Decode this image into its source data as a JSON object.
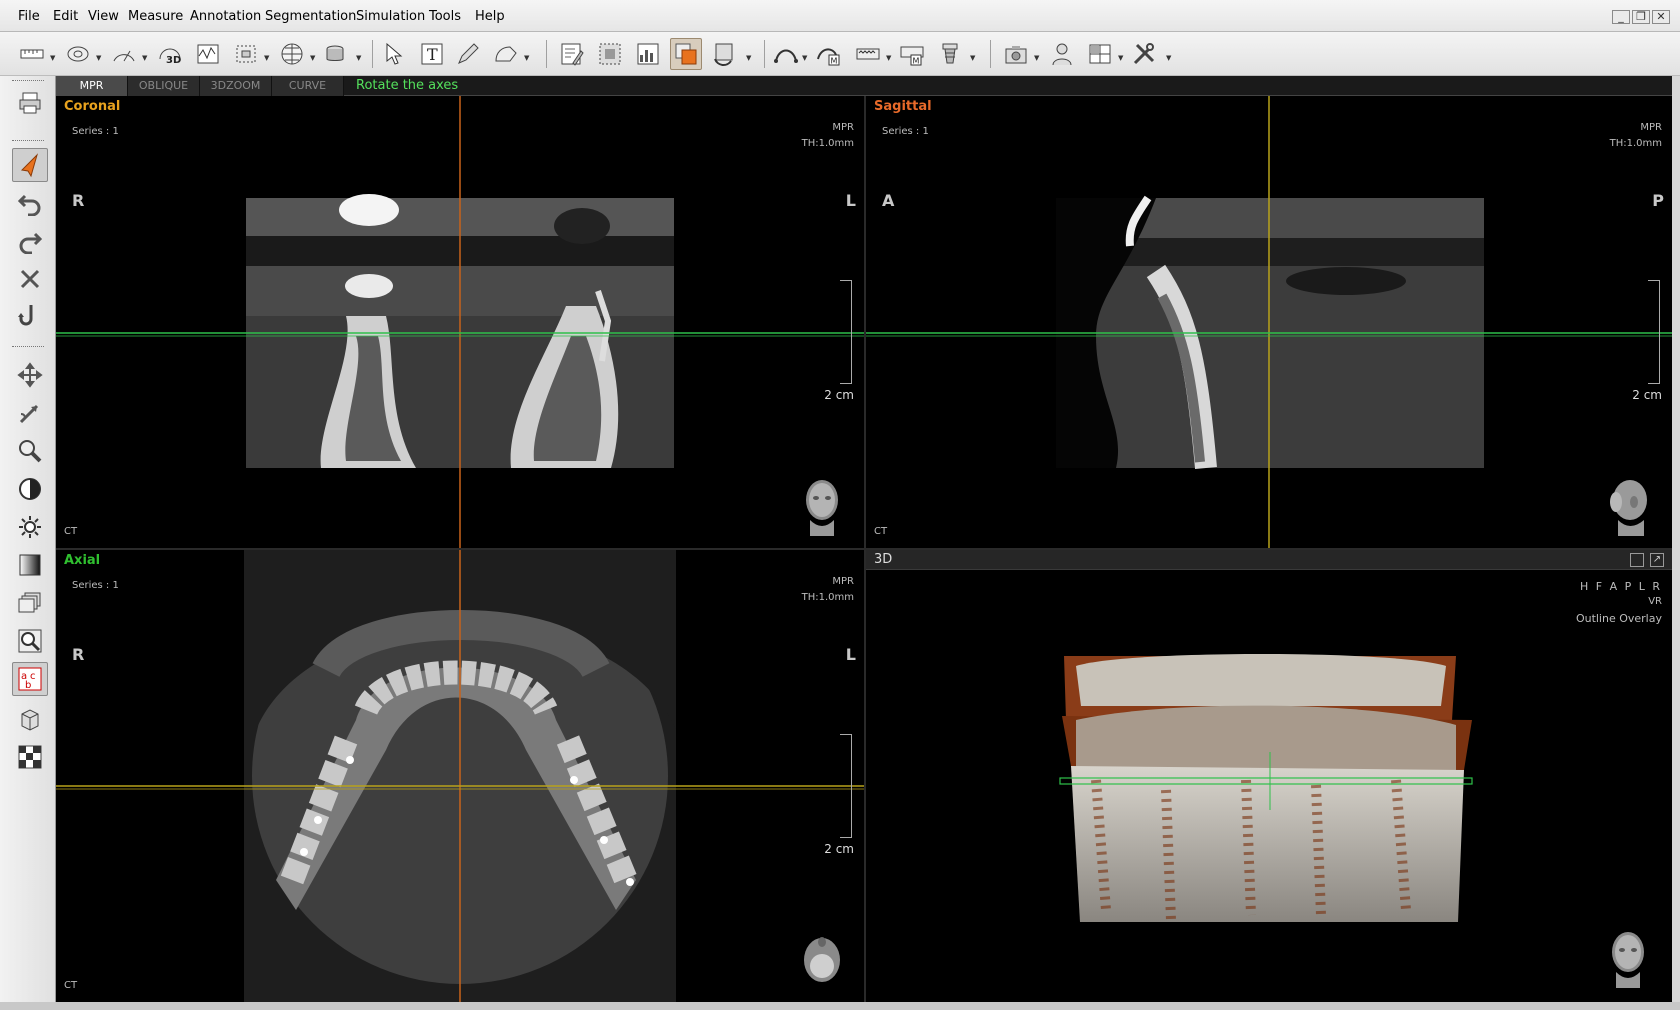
{
  "menu": [
    "File",
    "Edit",
    "View",
    "Measure",
    "Annotation",
    "Segmentation",
    "Simulation",
    "Tools",
    "Help"
  ],
  "window_controls": {
    "minimize": "_",
    "restore": "❐",
    "close": "✕"
  },
  "toolbar_icons": [
    "ruler-icon",
    "tape-measure-icon",
    "angle-icon",
    "3d-volume-icon",
    "profile-graph-icon",
    "roi-box-icon",
    "grid-icon",
    "cylinder-icon",
    "select-arrow-icon",
    "text-tool-icon",
    "pencil-icon",
    "shape-tool-icon",
    "edit-report-icon",
    "region-icon",
    "histogram-icon",
    "overlay-layers-icon",
    "rotate-reset-icon",
    "curve-icon",
    "curve-m-icon",
    "panoramic-icon",
    "panoramic-m-icon",
    "implant-icon",
    "camera-icon",
    "patient-icon",
    "layout-icon",
    "settings-tools-icon"
  ],
  "left_tools": [
    "print-icon",
    "pointer-icon",
    "undo-icon",
    "redo-icon",
    "delete-icon",
    "rotate-axis-icon",
    "pan-icon",
    "scroll-icon",
    "zoom-icon",
    "contrast-icon",
    "brightness-icon",
    "gradient-icon",
    "stack-icon",
    "magnify-icon",
    "annotation-text-icon",
    "3d-box-icon",
    "checker-icon"
  ],
  "tabs": [
    {
      "label": "MPR",
      "active": true
    },
    {
      "label": "OBLIQUE"
    },
    {
      "label": "3DZOOM"
    },
    {
      "label": "CURVE"
    }
  ],
  "status": "Rotate the axes",
  "coronal": {
    "title": "Coronal",
    "series": "Series : 1",
    "mode": "MPR",
    "thickness": "TH:1.0mm",
    "left": "R",
    "right": "L",
    "scale": "2 cm",
    "modality": "CT",
    "title_color": "#e8a21e"
  },
  "sagittal": {
    "title": "Sagittal",
    "series": "Series : 1",
    "mode": "MPR",
    "thickness": "TH:1.0mm",
    "left": "A",
    "right": "P",
    "scale": "2 cm",
    "modality": "CT",
    "title_color": "#e86a2a"
  },
  "axial": {
    "title": "Axial",
    "series": "Series : 1",
    "mode": "MPR",
    "thickness": "TH:1.0mm",
    "left": "R",
    "right": "L",
    "scale": "2 cm",
    "modality": "CT",
    "title_color": "#30c030"
  },
  "volume3d": {
    "title": "3D",
    "orient_letters": "H F A P L R",
    "render_mode": "VR",
    "overlay": "Outline Overlay"
  },
  "colors": {
    "orange_axis": "#c8631a",
    "yellow_axis": "#b8a21a",
    "green_axis": "#2ec04a"
  }
}
